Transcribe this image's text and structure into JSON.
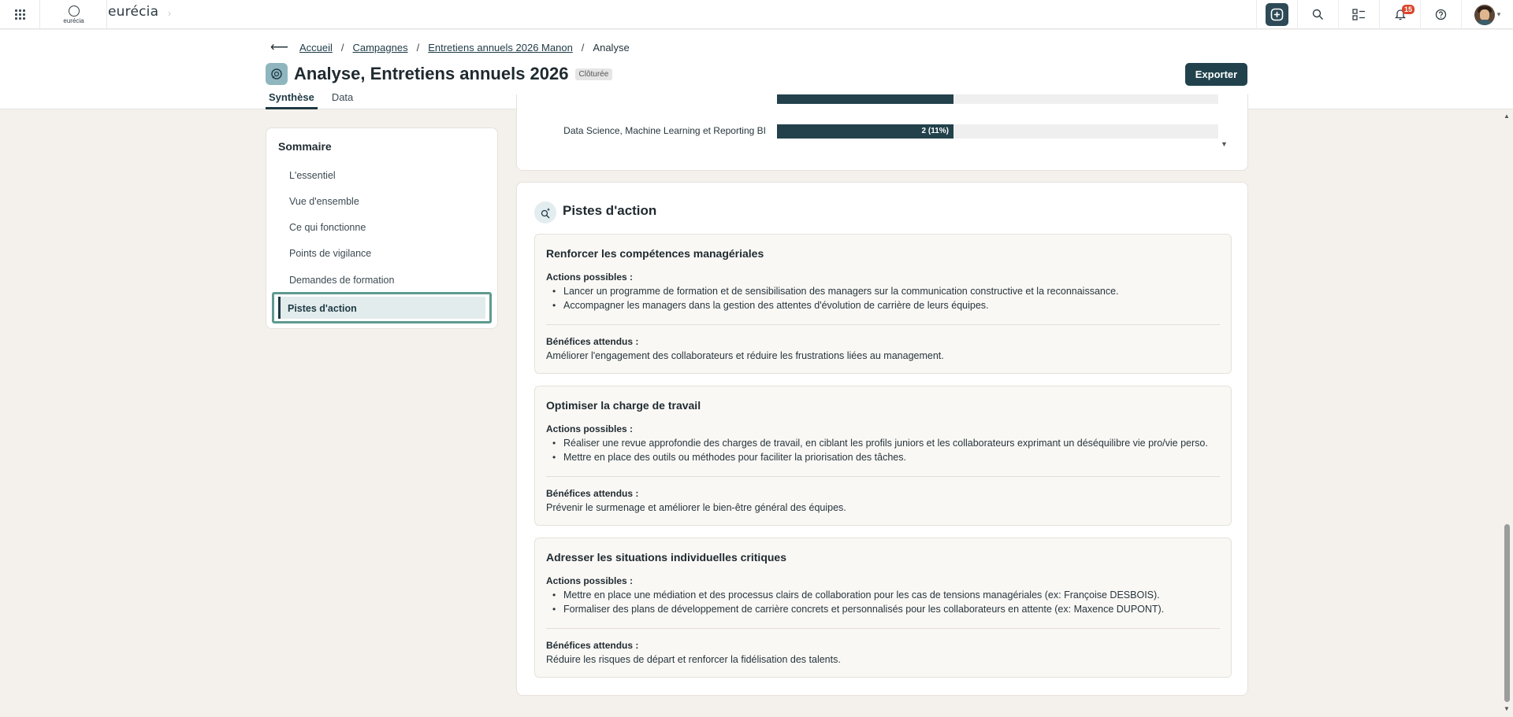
{
  "brand": {
    "logo_small": "eurécia",
    "name": "eurécia"
  },
  "topbar": {
    "notifications_count": "15"
  },
  "breadcrumb": {
    "items": [
      "Accueil",
      "Campagnes",
      "Entretiens annuels 2026 Manon",
      "Analyse"
    ]
  },
  "header": {
    "title": "Analyse, Entretiens annuels 2026",
    "status": "Clôturée",
    "export_label": "Exporter",
    "tabs": [
      "Synthèse",
      "Data"
    ]
  },
  "summary": {
    "title": "Sommaire",
    "items": [
      "L'essentiel",
      "Vue d'ensemble",
      "Ce qui fonctionne",
      "Points de vigilance",
      "Demandes de formation",
      "Pistes d'action"
    ],
    "active_index": 5
  },
  "chart_data": {
    "type": "bar",
    "categories": [
      "Data Science, Machine Learning et Reporting BI"
    ],
    "values": [
      2
    ],
    "labels": [
      "2 (11%)"
    ]
  },
  "actions": {
    "title": "Pistes d'action",
    "actions_label": "Actions possibles :",
    "benefits_label": "Bénéfices attendus :",
    "pistes": [
      {
        "title": "Renforcer les compétences managériales",
        "actions": [
          "Lancer un programme de formation et de sensibilisation des managers sur la communication constructive et la reconnaissance.",
          "Accompagner les managers dans la gestion des attentes d'évolution de carrière de leurs équipes."
        ],
        "benefits": "Améliorer l'engagement des collaborateurs et réduire les frustrations liées au management."
      },
      {
        "title": "Optimiser la charge de travail",
        "actions": [
          "Réaliser une revue approfondie des charges de travail, en ciblant les profils juniors et les collaborateurs exprimant un déséquilibre vie pro/vie perso.",
          "Mettre en place des outils ou méthodes pour faciliter la priorisation des tâches."
        ],
        "benefits": "Prévenir le surmenage et améliorer le bien-être général des équipes."
      },
      {
        "title": "Adresser les situations individuelles critiques",
        "actions": [
          "Mettre en place une médiation et des processus clairs de collaboration pour les cas de tensions managériales (ex: Françoise DESBOIS).",
          "Formaliser des plans de développement de carrière concrets et personnalisés pour les collaborateurs en attente (ex: Maxence DUPONT)."
        ],
        "benefits": "Réduire les risques de départ et renforcer la fidélisation des talents."
      }
    ]
  }
}
